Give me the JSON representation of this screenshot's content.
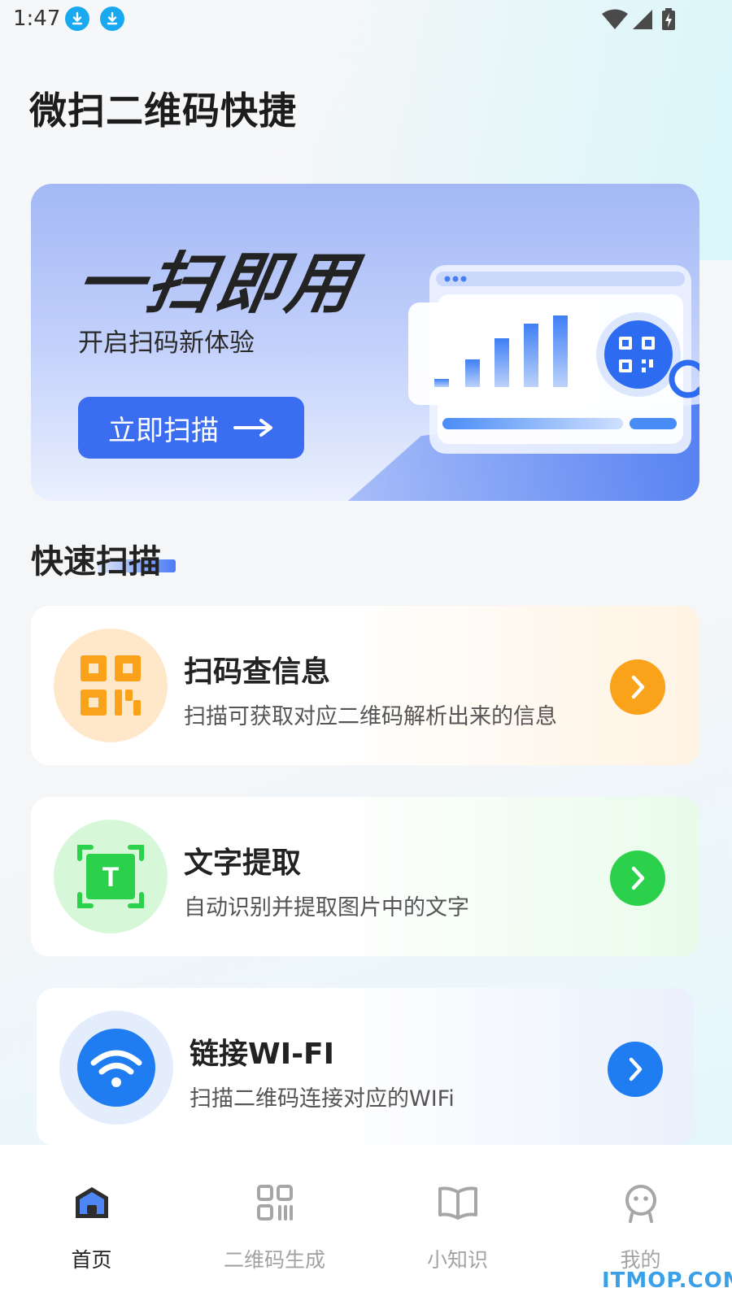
{
  "status_bar": {
    "time": "1:47",
    "icons": [
      "download-icon",
      "download-icon",
      "wifi-signal-icon",
      "cell-signal-icon",
      "battery-charging-icon"
    ]
  },
  "app": {
    "title": "微扫二维码快捷"
  },
  "banner": {
    "headline": "一扫即用",
    "subtitle": "开启扫码新体验",
    "button_label": "立即扫描",
    "button_icon": "arrow-right-icon"
  },
  "section": {
    "title": "快速扫描"
  },
  "features": [
    {
      "title": "扫码查信息",
      "desc": "扫描可获取对应二维码解析出来的信息",
      "icon": "qr-code-icon",
      "accent": "#f9a21a"
    },
    {
      "title": "文字提取",
      "desc": "自动识别并提取图片中的文字",
      "icon": "text-scan-icon",
      "accent": "#2bd14b"
    },
    {
      "title": "链接WI-FI",
      "desc": "扫描二维码连接对应的WIFi",
      "icon": "wifi-icon",
      "accent": "#1f7cf1"
    }
  ],
  "bottom_nav": {
    "items": [
      {
        "label": "首页",
        "icon": "home-icon",
        "active": true
      },
      {
        "label": "二维码生成",
        "icon": "qr-grid-icon",
        "active": false
      },
      {
        "label": "小知识",
        "icon": "book-icon",
        "active": false
      },
      {
        "label": "我的",
        "icon": "profile-icon",
        "active": false
      }
    ]
  },
  "watermark": "ITMOP.COM",
  "colors": {
    "primary": "#3a6df0",
    "orange": "#f9a21a",
    "green": "#2bd14b",
    "blue": "#1f7cf1"
  }
}
